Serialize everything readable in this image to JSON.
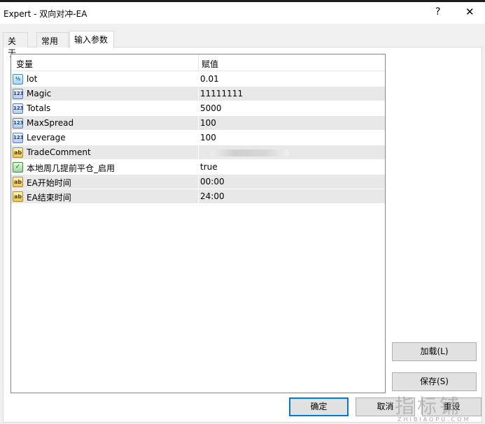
{
  "window": {
    "title": "Expert - 双向对冲-EA",
    "help_glyph": "?",
    "close_glyph": "✕"
  },
  "tabs": [
    {
      "label": "关于",
      "active": false
    },
    {
      "label": "常用",
      "active": false
    },
    {
      "label": "输入参数",
      "active": true
    }
  ],
  "grid": {
    "headers": {
      "variable": "变量",
      "value": "赋值"
    },
    "rows": [
      {
        "icon": "double-type-icon",
        "icon_text": "½",
        "name": "lot",
        "value": "0.01"
      },
      {
        "icon": "integer-type-icon",
        "icon_text": "123",
        "name": "Magic",
        "value": "11111111"
      },
      {
        "icon": "integer-type-icon",
        "icon_text": "123",
        "name": "Totals",
        "value": "5000"
      },
      {
        "icon": "integer-type-icon",
        "icon_text": "123",
        "name": "MaxSpread",
        "value": "100"
      },
      {
        "icon": "integer-type-icon",
        "icon_text": "123",
        "name": "Leverage",
        "value": "100"
      },
      {
        "icon": "string-type-icon",
        "icon_text": "ab",
        "name": "TradeComment",
        "value": ""
      },
      {
        "icon": "bool-type-icon",
        "icon_text": "✓",
        "name": "本地周几提前平仓_启用",
        "value": "true"
      },
      {
        "icon": "string-type-icon",
        "icon_text": "ab",
        "name": "EA开始时间",
        "value": "00:00"
      },
      {
        "icon": "string-type-icon",
        "icon_text": "ab",
        "name": "EA结束时间",
        "value": "24:00"
      }
    ]
  },
  "buttons": {
    "load": "加载(L)",
    "save": "保存(S)",
    "ok": "确定",
    "cancel": "取消",
    "reset": "重设"
  },
  "watermark": {
    "main": "指标铺",
    "sub": "ZHIBIAOPU.COM"
  },
  "colors": {
    "accent": "#0078d7",
    "alt_row": "#e8e8e8",
    "dialog_bg": "#f0f0f0"
  }
}
